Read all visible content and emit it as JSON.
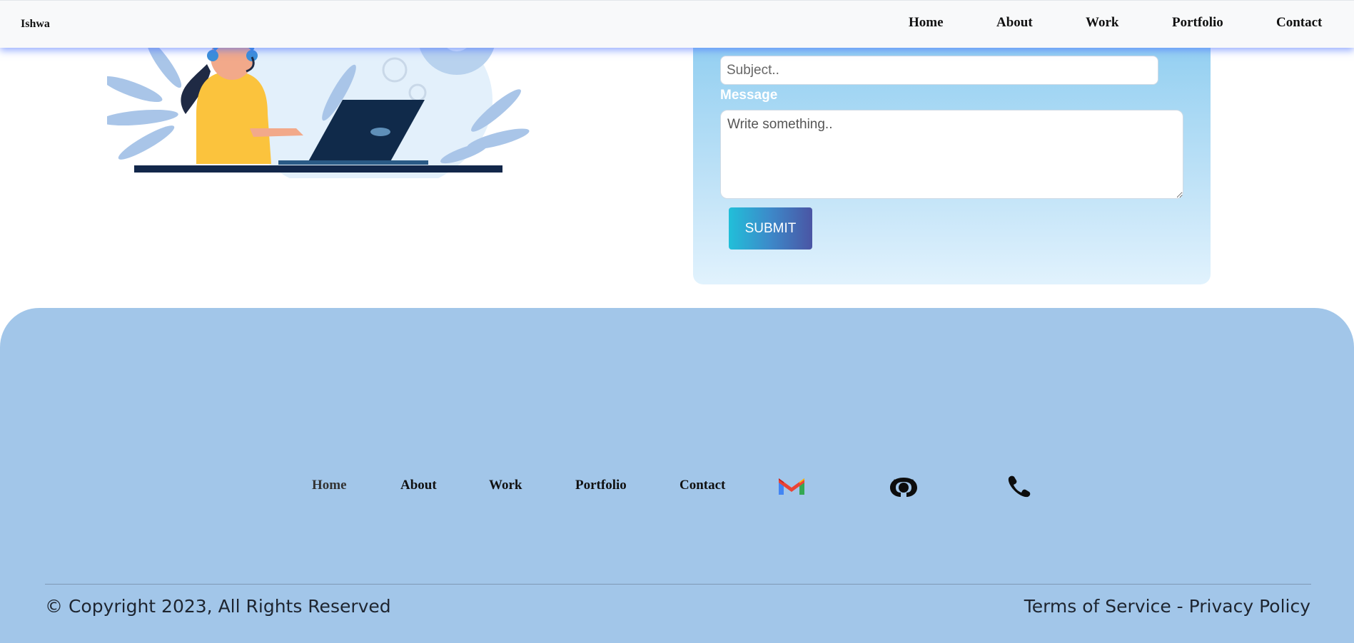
{
  "navbar": {
    "brand": "Ishwa",
    "links": [
      "Home",
      "About",
      "Work",
      "Portfolio",
      "Contact"
    ]
  },
  "form": {
    "subject_placeholder": "Subject..",
    "message_label": "Message",
    "message_placeholder": "Write something..",
    "submit_label": "SUBMIT"
  },
  "footer": {
    "links": [
      "Home",
      "About",
      "Work",
      "Portfolio",
      "Contact"
    ],
    "icons": [
      "gmail-icon",
      "github-icon",
      "phone-icon"
    ],
    "copyright": "© Copyright 2023, All Rights Reserved",
    "terms": "Terms of Service",
    "separator": " - ",
    "privacy": "Privacy Policy",
    "background": "#a2c6e9"
  }
}
